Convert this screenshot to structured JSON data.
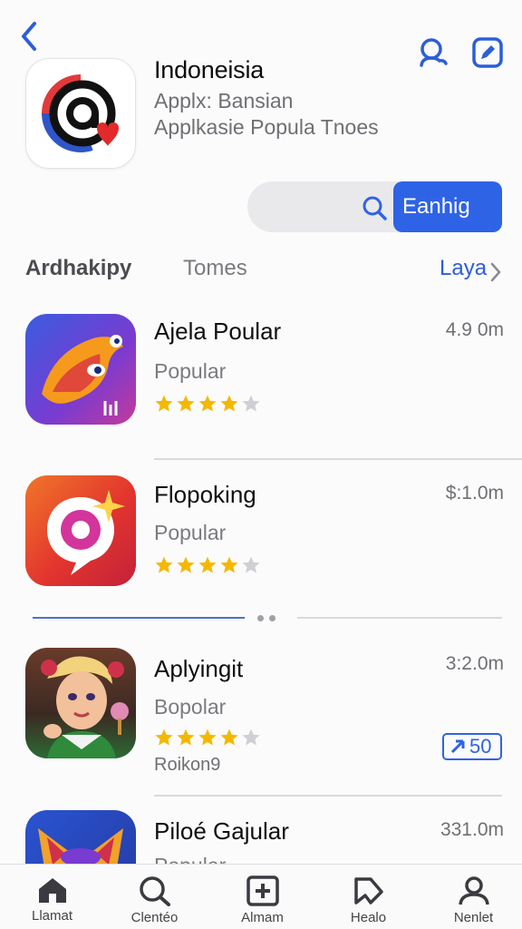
{
  "header": {
    "app_title": "Indoneisia",
    "subtitle_1": "Applx: Bansian",
    "subtitle_2": "Applkasie Popula Tnoes"
  },
  "search": {
    "button_label": "Eanhig"
  },
  "tabs": {
    "tab_1": "Ardhakipy",
    "tab_2": "Tomes",
    "tab_3": "Laya"
  },
  "apps": [
    {
      "name": "Ajela Poular",
      "category": "Popular",
      "size": "4.9 0m",
      "rating": 4
    },
    {
      "name": "Flopoking",
      "category": "Popular",
      "size": "$:1.0m",
      "rating": 4
    },
    {
      "name": "Aplyingit",
      "category": "Bopolar",
      "size": "3:2.0m",
      "rating": 4,
      "developer": "Roikon9",
      "badge": "50"
    },
    {
      "name": "Piloé Gajular",
      "category": "Popular",
      "size": "331.0m"
    }
  ],
  "tabbar": [
    {
      "label": "Llamat",
      "icon": "home-icon"
    },
    {
      "label": "Clentéo",
      "icon": "search-icon"
    },
    {
      "label": "Almam",
      "icon": "apps-icon"
    },
    {
      "label": "Healo",
      "icon": "bookmark-icon"
    },
    {
      "label": "Nenlet",
      "icon": "profile-icon"
    }
  ],
  "colors": {
    "accent": "#2f63e6",
    "star": "#f5b800",
    "star_off": "#cfcfd4"
  }
}
